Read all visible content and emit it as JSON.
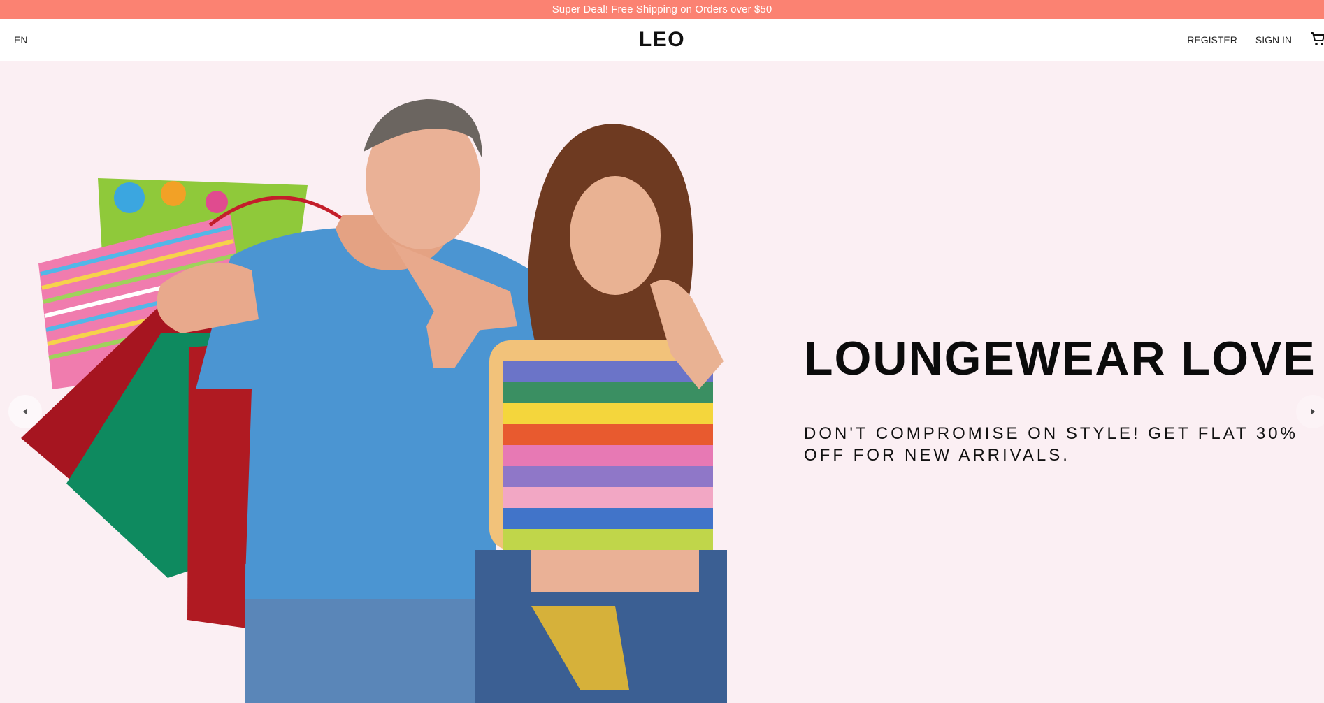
{
  "announcement": {
    "text": "Super Deal! Free Shipping on Orders over $50"
  },
  "nav": {
    "language": "EN",
    "logo": "LEO",
    "register": "REGISTER",
    "sign_in": "SIGN IN",
    "cart_icon": "cart-icon"
  },
  "hero": {
    "title": "LOUNGEWEAR LOVE",
    "subtitle": "DON'T COMPROMISE ON STYLE! GET FLAT 30% OFF FOR NEW ARRIVALS.",
    "prev_icon": "chevron-left-icon",
    "next_icon": "chevron-right-icon"
  },
  "colors": {
    "announcement_bg": "#fb8272",
    "hero_bg": "#fbeff3",
    "text": "#111111"
  }
}
